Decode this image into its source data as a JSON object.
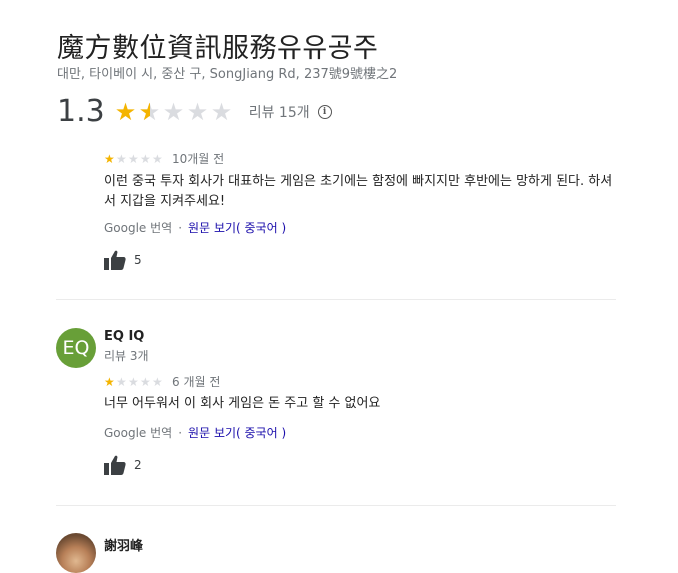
{
  "place": {
    "name": "魔方數位資訊服務유유공주",
    "address": "대만, 타이베이 시, 중산 구, SongJiang Rd, 237號9號樓之2",
    "rating": "1.3",
    "rating_fraction": 0.26,
    "review_count_label": "리뷰 15개",
    "info_icon": "info-icon"
  },
  "reviews": [
    {
      "stars": 1,
      "time": "10개월 전",
      "text": "이런 중국 투자 회사가 대표하는 게임은 초기에는 함정에 빠지지만 후반에는 망하게 된다. 하셔서 지갑을 지켜주세요!",
      "translated_by": "Google 번역",
      "original_link": "원문 보기( 중국어 )",
      "likes": "5"
    },
    {
      "author": "EQ IQ",
      "avatar_initials": "EQ",
      "avatar_color": "#689f38",
      "meta": "리뷰 3개",
      "stars": 1,
      "time": "6 개월 전",
      "text": "너무 어두워서 이 회사 게임은 돈 주고 할 수 없어요",
      "translated_by": "Google 번역",
      "original_link": "원문 보기( 중국어 )",
      "likes": "2"
    },
    {
      "author": "謝羽峰"
    }
  ],
  "icons": {
    "star": "★",
    "thumb": "thumbs-up-icon",
    "separator": "·"
  },
  "colors": {
    "star_filled": "#f4b400",
    "star_empty": "#dadce0",
    "link": "#1a0dab"
  }
}
